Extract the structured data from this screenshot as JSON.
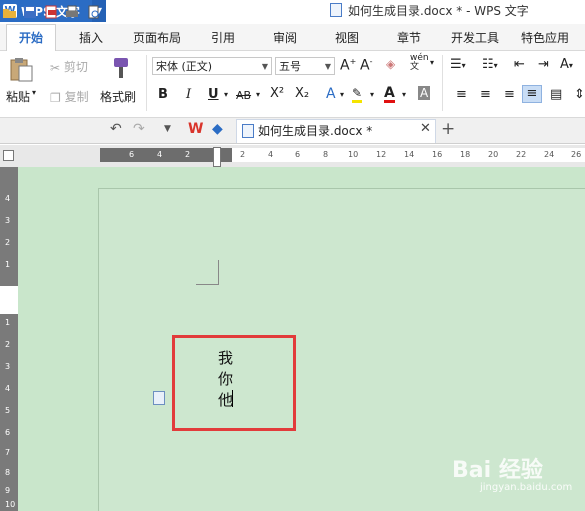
{
  "app": {
    "name": "WPS 文字",
    "logo_icon": "wps-logo-icon"
  },
  "window": {
    "title": "如何生成目录.docx * - WPS 文字"
  },
  "ribbon_tabs": [
    "开始",
    "插入",
    "页面布局",
    "引用",
    "审阅",
    "视图",
    "章节",
    "开发工具",
    "特色应用"
  ],
  "active_tab": "开始",
  "clipboard": {
    "paste": "粘贴",
    "cut": "剪切",
    "copy": "复制",
    "format_painter": "格式刷"
  },
  "font": {
    "name": "宋体 (正文)",
    "size": "五号"
  },
  "format_buttons": [
    "B",
    "I",
    "U",
    "AB",
    "X²",
    "X₂",
    "A",
    "A"
  ],
  "quick_access": [
    "open-folder-icon",
    "save-icon",
    "pdf-icon",
    "print-icon",
    "print-preview-icon",
    "undo-icon",
    "redo-icon"
  ],
  "doc_tab": {
    "label": "如何生成目录.docx *"
  },
  "ruler": {
    "h_ticks": [
      "6",
      "4",
      "2",
      "2",
      "4",
      "6",
      "8",
      "10",
      "12",
      "14",
      "16",
      "18",
      "20",
      "22",
      "24",
      "26"
    ],
    "v_ticks": [
      "4",
      "3",
      "2",
      "1",
      "1",
      "2",
      "3",
      "4",
      "5",
      "6",
      "7",
      "8",
      "9",
      "10"
    ]
  },
  "document": {
    "lines": [
      "我",
      "你",
      "他"
    ]
  },
  "watermark": {
    "text": "Bai 经验",
    "sub": "jingyan.baidu.com"
  },
  "colors": {
    "brand": "#2b6cc4",
    "page_bg": "#c9e6cb",
    "highlight_box": "#e23b3b"
  }
}
